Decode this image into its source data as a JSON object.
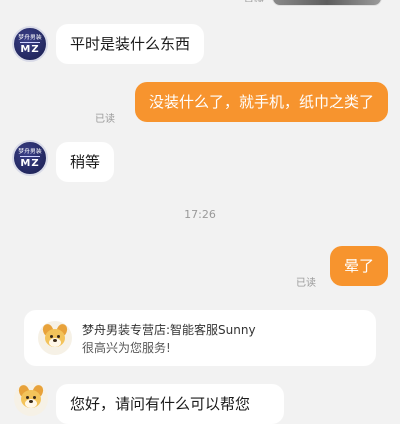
{
  "shop_avatar": {
    "line1": "梦舟男装",
    "line2": "MZ"
  },
  "messages": [
    {
      "side": "left",
      "text": "平时是装什么东西"
    },
    {
      "side": "right",
      "text": "没装什么了，就手机，纸巾之类了",
      "status": "已读"
    },
    {
      "side": "left",
      "text": "稍等"
    },
    {
      "side": "right",
      "text": "晕了",
      "status": "已读"
    }
  ],
  "timestamp": "17:26",
  "bot_card": {
    "name": "梦舟男装专营店:智能客服Sunny",
    "greeting": "很高兴为您服务!"
  },
  "next_message_partial": "您好，请问有什么可以帮您",
  "colors": {
    "background": "#f2f2f2",
    "self_bubble": "#f7942e",
    "other_bubble": "#ffffff"
  }
}
